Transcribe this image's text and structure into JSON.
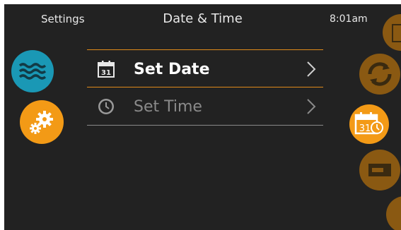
{
  "header": {
    "left": "Settings",
    "title": "Date & Time",
    "time": "8:01am"
  },
  "menu": {
    "calendar_number": "31",
    "items": [
      {
        "label": "Set Date",
        "active": true
      },
      {
        "label": "Set Time",
        "active": false
      }
    ]
  },
  "colors": {
    "background": "#222222",
    "accent_orange": "#f39a16",
    "water_blue": "#1a98b5",
    "inactive_text": "#8a8a8a"
  },
  "icons": [
    "water-waves-icon",
    "gears-icon",
    "calendar-icon",
    "clock-icon",
    "chevron-right-icon",
    "cycle-icon",
    "calendar-clock-icon",
    "display-icon"
  ]
}
